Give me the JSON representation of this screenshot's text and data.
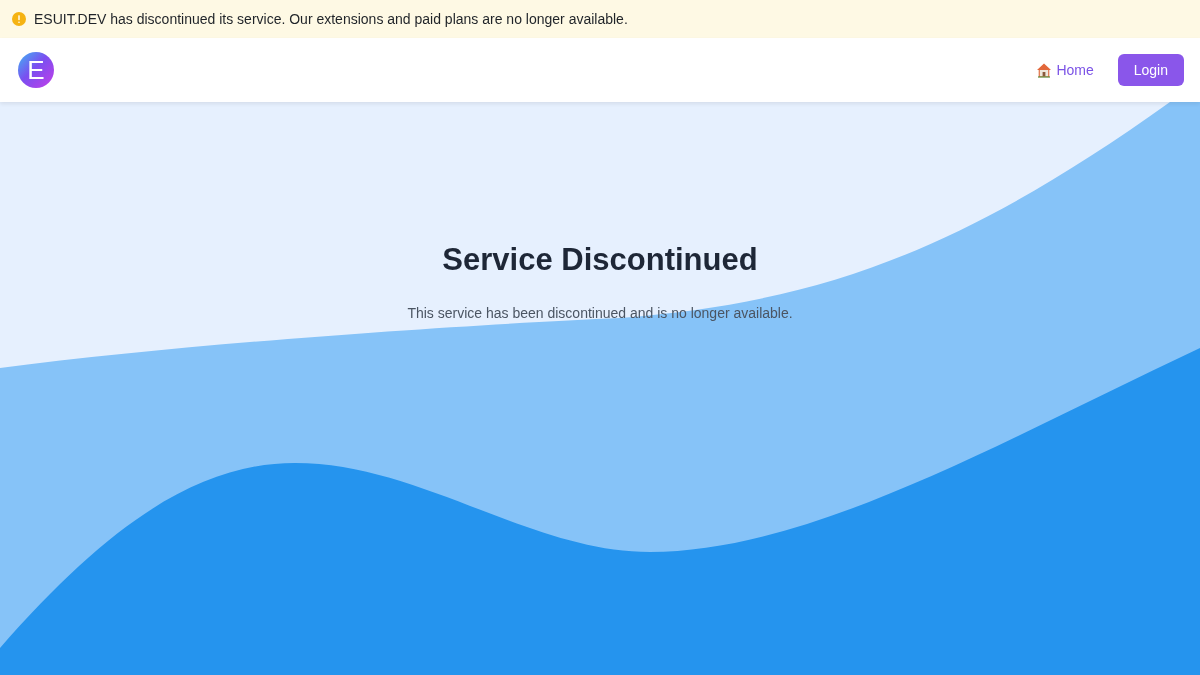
{
  "banner": {
    "text": "ESUIT.DEV has discontinued its service. Our extensions and paid plans are no longer available."
  },
  "navbar": {
    "logo": {
      "letter": "E"
    },
    "links": [
      {
        "label": "Home"
      }
    ],
    "login_button": "Login"
  },
  "hero": {
    "title": "Service Discontinued",
    "subtitle": "This service has been discontinued and is no longer available."
  }
}
